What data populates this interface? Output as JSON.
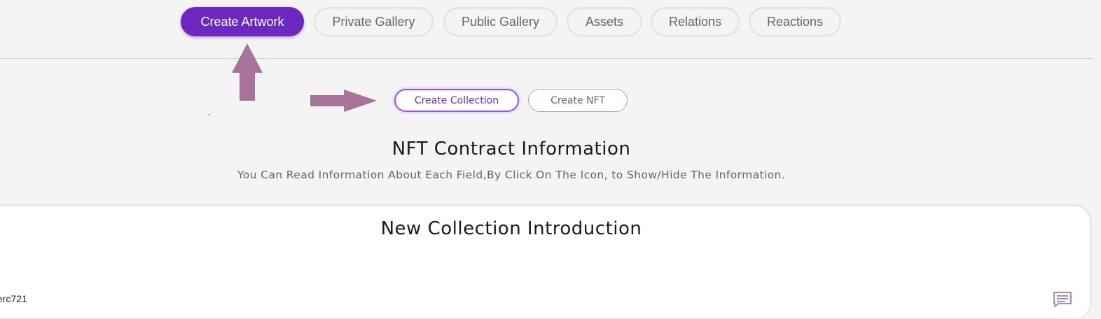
{
  "nav": {
    "items": [
      {
        "label": "Create Artwork",
        "active": true
      },
      {
        "label": "Private Gallery",
        "active": false
      },
      {
        "label": "Public Gallery",
        "active": false
      },
      {
        "label": "Assets",
        "active": false
      },
      {
        "label": "Relations",
        "active": false
      },
      {
        "label": "Reactions",
        "active": false
      }
    ]
  },
  "subtabs": [
    {
      "label": "Create Collection",
      "active": true
    },
    {
      "label": "Create NFT",
      "active": false
    }
  ],
  "section": {
    "title": "NFT Contract Information",
    "subtitle": "You Can Read Information About Each Field,By Click On The Icon, to Show/Hide The Information."
  },
  "card": {
    "title": "New Collection Introduction",
    "field_value": "erc721",
    "icon": "comment-icon"
  },
  "colors": {
    "accent": "#6c28bf",
    "arrow": "#a8739a",
    "subtab_border": "#9b55e6"
  },
  "icons": [
    "up-arrow-icon",
    "right-arrow-icon",
    "comment-icon"
  ]
}
